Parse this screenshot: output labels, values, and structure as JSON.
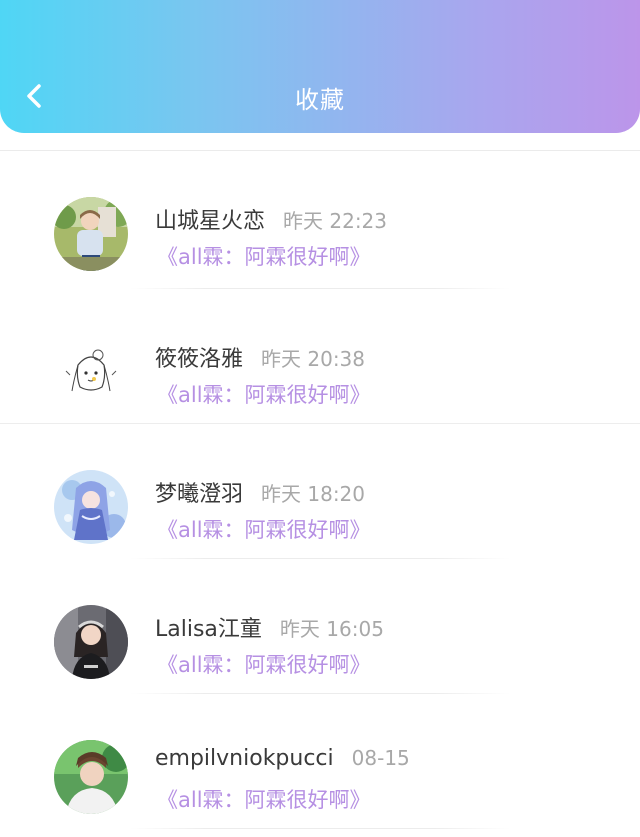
{
  "header": {
    "title": "收藏",
    "back_icon": "chevron-left-icon",
    "gradient": [
      "#4fd6f5",
      "#bc95ea"
    ]
  },
  "favorites": [
    {
      "name": "山城星火恋",
      "time": "昨天 22:23",
      "work": "《all霖：阿霖很好啊》",
      "avatar": "avatar-photo-boy"
    },
    {
      "name": "筱筱洛雅",
      "time": "昨天 20:38",
      "work": "《all霖：阿霖很好啊》",
      "avatar": "avatar-sketch-girl"
    },
    {
      "name": "梦曦澄羽",
      "time": "昨天 18:20",
      "work": "《all霖：阿霖很好啊》",
      "avatar": "avatar-anime-girl"
    },
    {
      "name": "Lalisa江童",
      "time": "昨天 16:05",
      "work": "《all霖：阿霖很好啊》",
      "avatar": "avatar-photo-girl"
    },
    {
      "name": "empilvniokpucci",
      "time": "08-15",
      "work": "《all霖：阿霖很好啊》",
      "avatar": "avatar-photo-man"
    }
  ],
  "colors": {
    "name": "#3a3a3a",
    "time": "#a8a8a8",
    "work_link": "#b690e3"
  }
}
